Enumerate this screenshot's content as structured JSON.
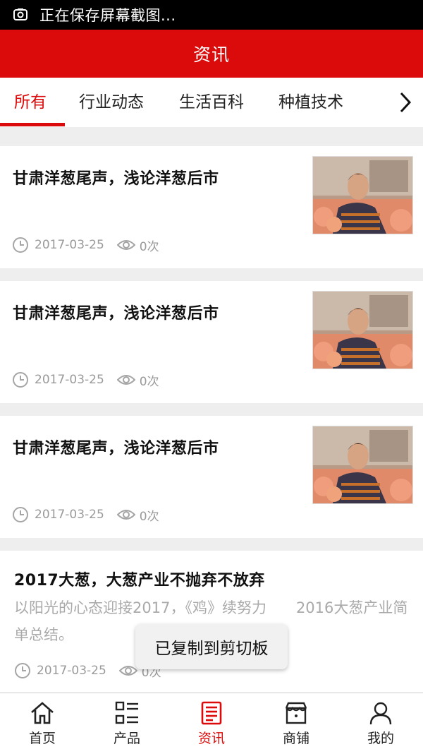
{
  "status_bar": {
    "text": "正在保存屏幕截图..."
  },
  "header": {
    "title": "资讯"
  },
  "tabs": [
    {
      "label": "所有",
      "active": true
    },
    {
      "label": "行业动态",
      "active": false
    },
    {
      "label": "生活百科",
      "active": false
    },
    {
      "label": "种植技术",
      "active": false
    }
  ],
  "articles": [
    {
      "title": "甘肃洋葱尾声，浅论洋葱后市",
      "date": "2017-03-25",
      "views": "0次",
      "thumbnail": "photo-man-with-onions"
    },
    {
      "title": "甘肃洋葱尾声，浅论洋葱后市",
      "date": "2017-03-25",
      "views": "0次",
      "thumbnail": "photo-man-with-onions"
    },
    {
      "title": "甘肃洋葱尾声，浅论洋葱后市",
      "date": "2017-03-25",
      "views": "0次",
      "thumbnail": "photo-man-with-onions"
    },
    {
      "title": "2017大葱，大葱产业不抛弃不放弃",
      "summary": "以阳光的心态迎接2017，《鸡》续努力　　2016大葱产业简单总结。",
      "date": "2017-03-25",
      "views": "0次"
    }
  ],
  "toast": {
    "text": "已复制到剪切板"
  },
  "bottom_nav": [
    {
      "label": "首页",
      "icon": "home-icon",
      "active": false
    },
    {
      "label": "产品",
      "icon": "grid-list-icon",
      "active": false
    },
    {
      "label": "资讯",
      "icon": "news-icon",
      "active": true
    },
    {
      "label": "商铺",
      "icon": "shop-icon",
      "active": false
    },
    {
      "label": "我的",
      "icon": "user-icon",
      "active": false
    }
  ],
  "colors": {
    "accent": "#dc0b0b",
    "meta_gray": "#9a9a9a",
    "background": "#eeeeee"
  }
}
